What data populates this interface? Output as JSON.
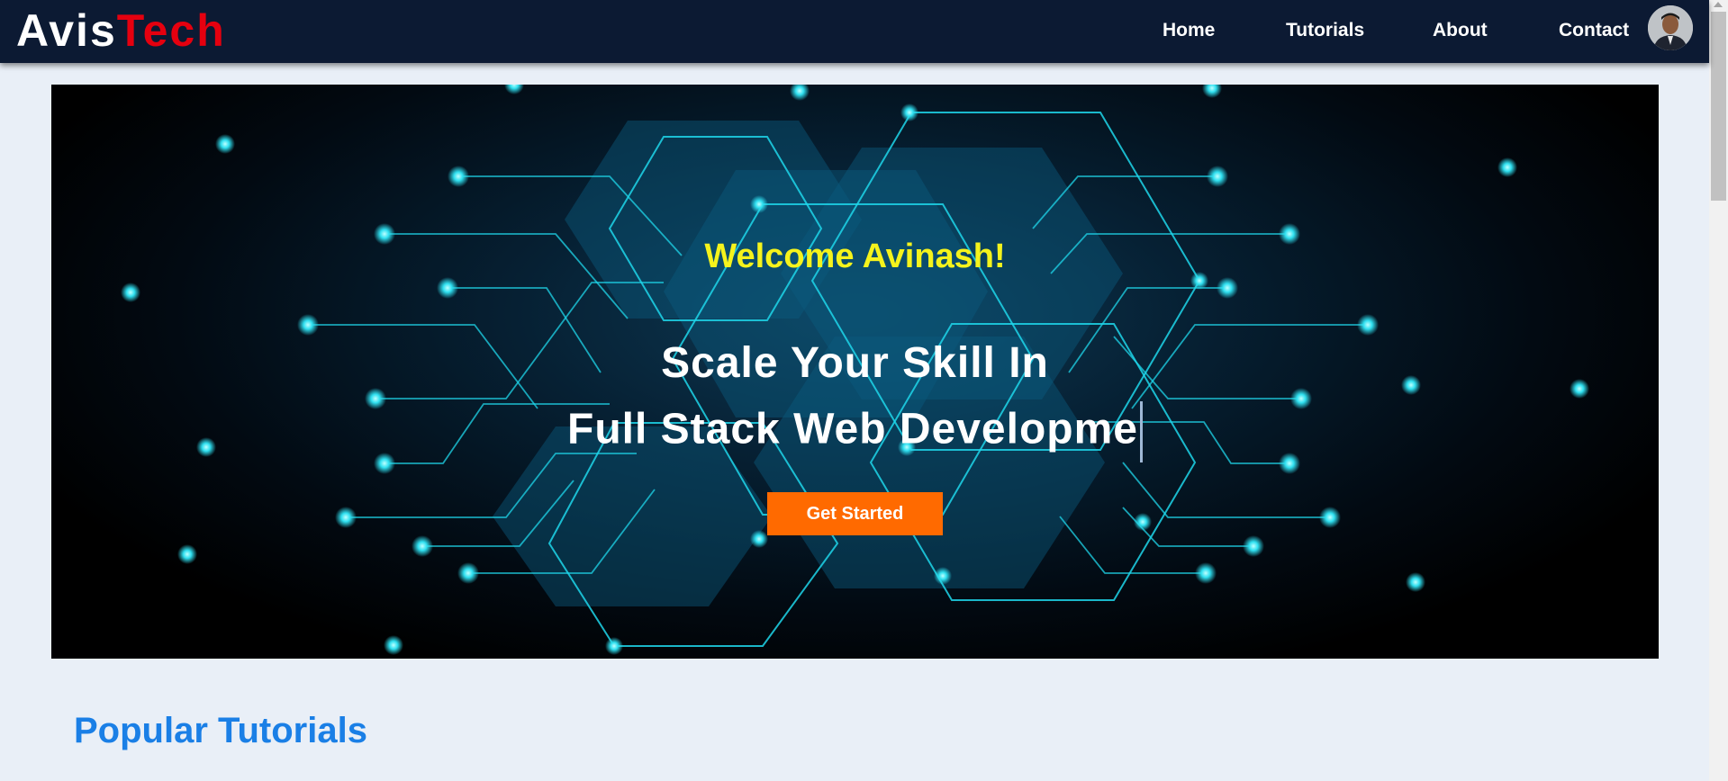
{
  "brand": {
    "part1": "Avis",
    "part2": "Tech"
  },
  "nav": {
    "items": [
      {
        "label": "Home"
      },
      {
        "label": "Tutorials"
      },
      {
        "label": "About"
      },
      {
        "label": "Contact"
      }
    ],
    "avatar_icon": "user-avatar"
  },
  "hero": {
    "welcome": "Welcome Avinash!",
    "line1": "Scale Your Skill In",
    "line2": "Full Stack Web Developme",
    "cta_label": "Get Started"
  },
  "popular": {
    "title": "Popular Tutorials"
  },
  "colors": {
    "nav_bg": "#0c1a33",
    "brand_accent": "#e5000f",
    "welcome": "#f5f31c",
    "cta": "#ff6a00",
    "section_title": "#1a7fe6",
    "page_bg": "#e9eff7",
    "circuit": "#1fd6ea"
  }
}
